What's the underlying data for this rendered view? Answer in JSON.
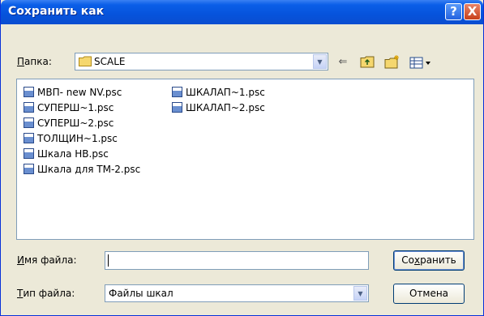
{
  "window": {
    "title": "Сохранить как"
  },
  "titlebar": {
    "help_glyph": "?",
    "close_glyph": "X"
  },
  "lookin": {
    "label_u": "П",
    "label_rest": "апка:",
    "value": "SCALE"
  },
  "toolbar": {
    "icons": [
      "back-arrow-icon",
      "up-folder-icon",
      "new-folder-icon",
      "view-menu-icon"
    ]
  },
  "files": [
    "МВП- new NV.psc",
    "СУПЕРШ~1.psc",
    "СУПЕРШ~2.psc",
    "ТОЛЩИН~1.psc",
    "Шкала НВ.psc",
    "Шкала для ТМ-2.psc",
    "ШКАЛАП~1.psc",
    "ШКАЛАП~2.psc"
  ],
  "filename": {
    "label_u": "И",
    "label_rest": "мя файла:",
    "value": ""
  },
  "filetype": {
    "label_u": "Т",
    "label_rest": "ип файла:",
    "value": "Файлы шкал"
  },
  "buttons": {
    "save_u": "х",
    "save_pre": "Со",
    "save_post": "ранить",
    "cancel": "Отмена"
  }
}
